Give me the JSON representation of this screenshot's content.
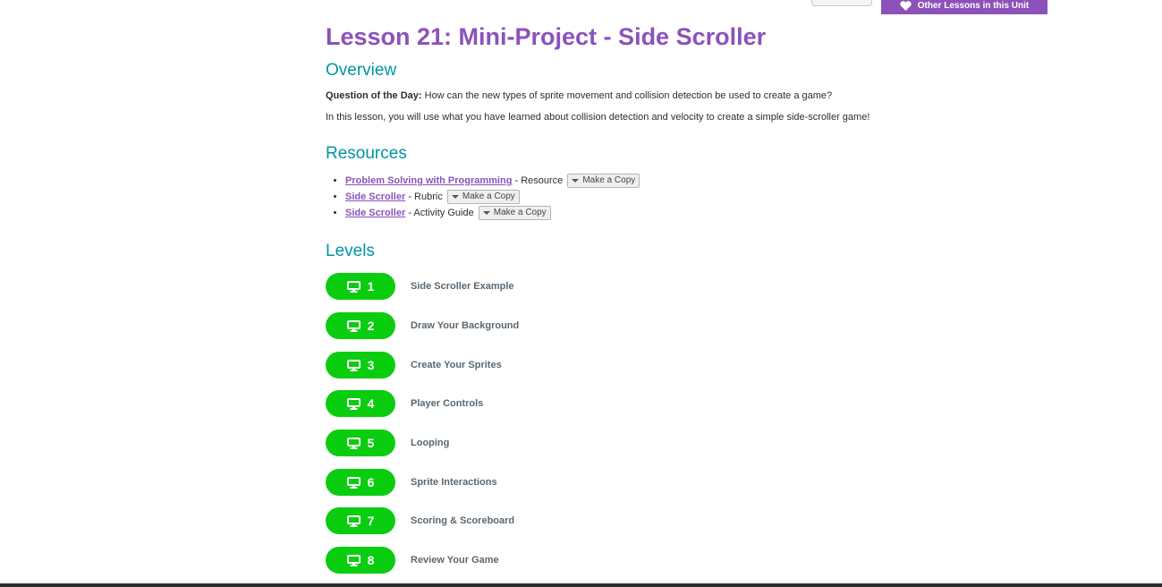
{
  "header": {
    "other_lessons_label": "Other Lessons in this Unit"
  },
  "lesson": {
    "title": "Lesson 21: Mini-Project - Side Scroller"
  },
  "overview": {
    "heading": "Overview",
    "question_label": "Question of the Day:",
    "question_text": " How can the new types of sprite movement and collision detection be used to create a game?",
    "description": "In this lesson, you will use what you have learned about collision detection and velocity to create a simple side-scroller game!"
  },
  "resources": {
    "heading": "Resources",
    "items": [
      {
        "link": "Problem Solving with Programming",
        "type": " - Resource",
        "copy_label": "Make a Copy"
      },
      {
        "link": "Side Scroller",
        "type": " - Rubric",
        "copy_label": "Make a Copy"
      },
      {
        "link": "Side Scroller",
        "type": " - Activity Guide",
        "copy_label": "Make a Copy"
      }
    ]
  },
  "levels": {
    "heading": "Levels",
    "icon": "monitor-icon",
    "items": [
      {
        "number": "1",
        "name": "Side Scroller Example"
      },
      {
        "number": "2",
        "name": "Draw Your Background"
      },
      {
        "number": "3",
        "name": "Create Your Sprites"
      },
      {
        "number": "4",
        "name": "Player Controls"
      },
      {
        "number": "5",
        "name": "Looping"
      },
      {
        "number": "6",
        "name": "Sprite Interactions"
      },
      {
        "number": "7",
        "name": "Scoring & Scoreboard"
      },
      {
        "number": "8",
        "name": "Review Your Game"
      }
    ]
  },
  "colors": {
    "accent_purple": "#8c52ba",
    "heading_teal": "#0094a4",
    "level_green": "#0acd10"
  }
}
